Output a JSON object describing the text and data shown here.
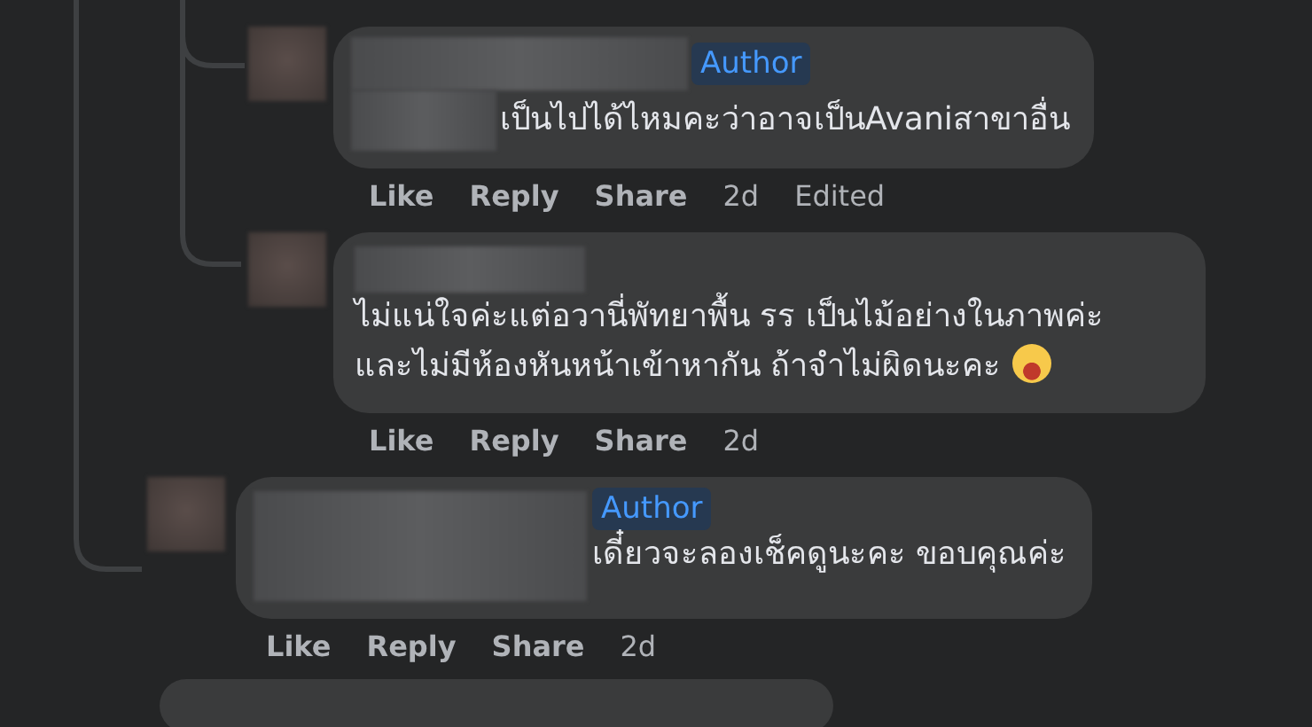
{
  "thread": [
    {
      "kind": "partial",
      "children": [
        {
          "kind": "prefixed",
          "author_badge": "Author",
          "text": "เป็นไปได้ไหมคะว่าอาจเป็นAvaniสาขาอื่น",
          "emoji": false,
          "actions": [
            {
              "label": "Like",
              "kind": "action"
            },
            {
              "label": "Reply",
              "kind": "action"
            },
            {
              "label": "Share",
              "kind": "action"
            },
            {
              "label": "2d",
              "kind": "time"
            },
            {
              "label": "Edited",
              "kind": "note"
            }
          ]
        },
        {
          "kind": "plain",
          "text": "ไม่แน่ใจค่ะแต่อวานี่พัทยาพื้น รร เป็นไม้อย่างในภาพค่ะ และไม่มีห้องหันหน้าเข้าหากัน ถ้าจำไม่ผิดนะคะ",
          "emoji": true,
          "actions": [
            {
              "label": "Like",
              "kind": "action"
            },
            {
              "label": "Reply",
              "kind": "action"
            },
            {
              "label": "Share",
              "kind": "action"
            },
            {
              "label": "2d",
              "kind": "time"
            }
          ]
        }
      ]
    },
    {
      "kind": "wide",
      "author_badge": "Author",
      "text": "เดี๋ยวจะลองเช็คดูนะคะ ขอบคุณค่ะ",
      "emoji": false,
      "actions": [
        {
          "label": "Like",
          "kind": "action"
        },
        {
          "label": "Reply",
          "kind": "action"
        },
        {
          "label": "Share",
          "kind": "action"
        },
        {
          "label": "2d",
          "kind": "time"
        }
      ]
    }
  ]
}
